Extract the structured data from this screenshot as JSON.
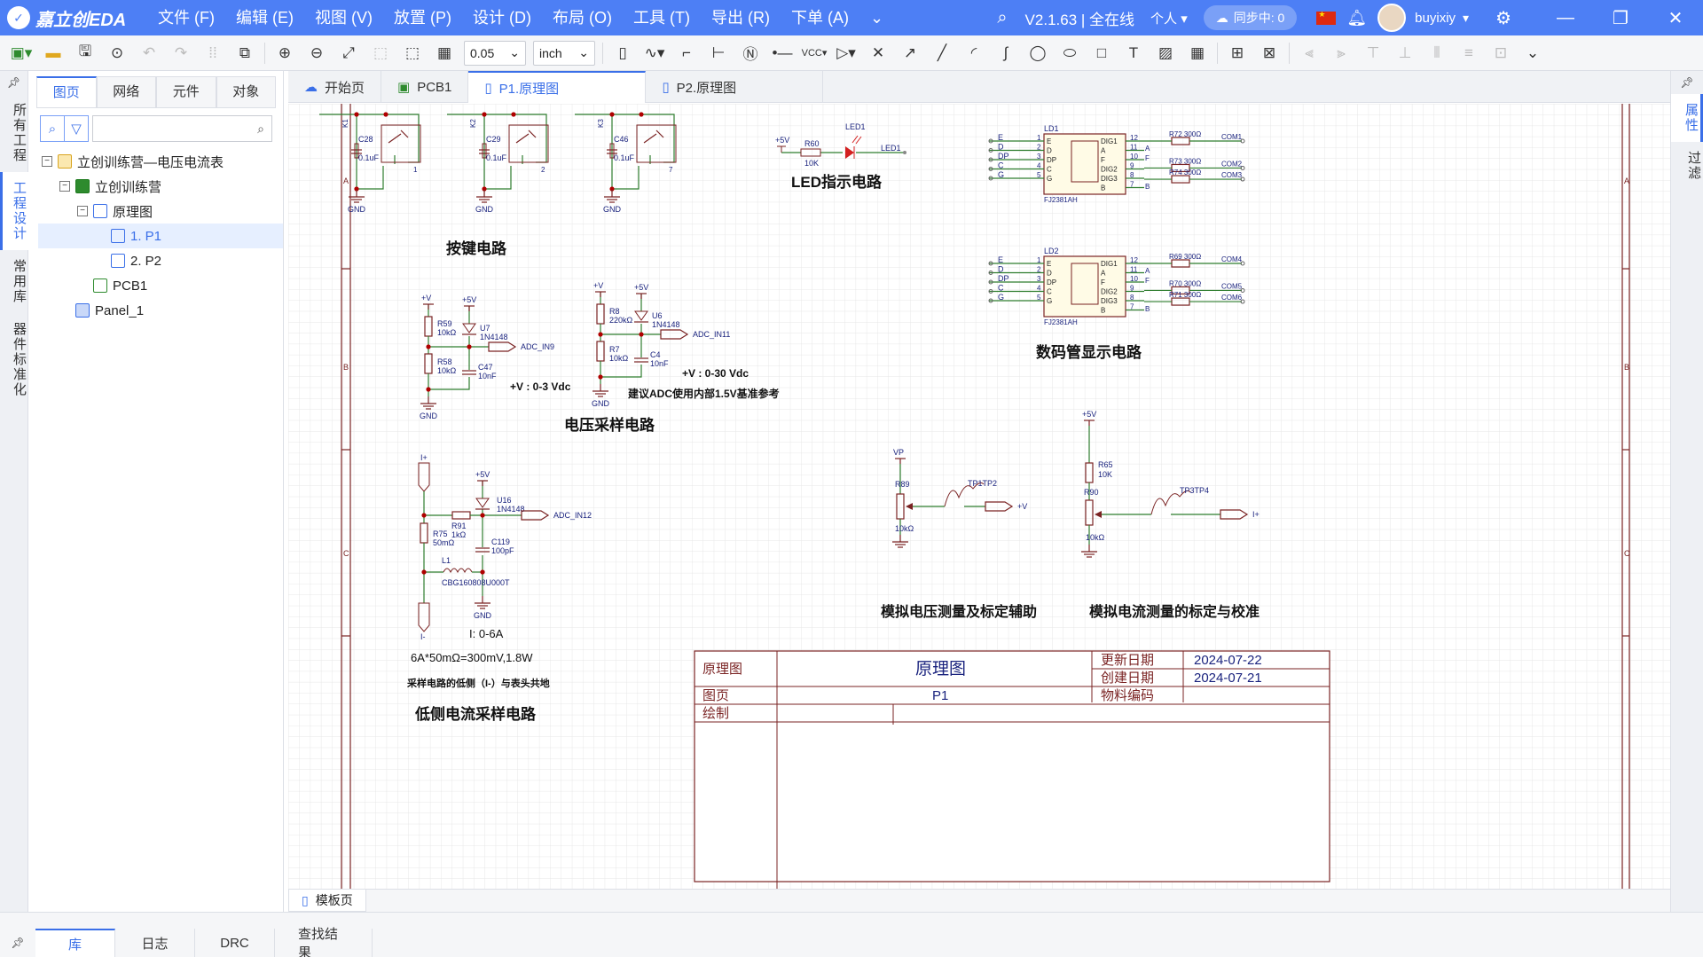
{
  "app": {
    "name": "嘉立创EDA",
    "version": "V2.1.63 | 全在线",
    "workspace": "个人",
    "sync": "同步中: 0",
    "user": "buyixiy"
  },
  "menu": [
    "文件 (F)",
    "编辑 (E)",
    "视图 (V)",
    "放置 (P)",
    "设计 (D)",
    "布局 (O)",
    "工具 (T)",
    "导出 (R)",
    "下单 (A)"
  ],
  "toolbar": {
    "grid": "0.05",
    "unit": "inch"
  },
  "left_rail": [
    "所有工程",
    "工程设计",
    "常用库",
    "器件标准化"
  ],
  "panel_tabs": [
    "图页",
    "网络",
    "元件",
    "对象"
  ],
  "tree": [
    {
      "label": "立创训练营—电压电流表",
      "level": 0
    },
    {
      "label": "立创训练营",
      "level": 1
    },
    {
      "label": "原理图",
      "level": 2
    },
    {
      "label": "1. P1",
      "level": 3,
      "selected": true
    },
    {
      "label": "2. P2",
      "level": 3
    },
    {
      "label": "PCB1",
      "level": 2
    },
    {
      "label": "Panel_1",
      "level": 1
    }
  ],
  "editor_tabs": [
    "开始页",
    "PCB1",
    "P1.原理图",
    "P2.原理图"
  ],
  "right_rail": [
    "属性",
    "过滤"
  ],
  "sheet_tab": "模板页",
  "bottom_tabs": [
    "库",
    "日志",
    "DRC",
    "查找结果"
  ],
  "schematic": {
    "titles": {
      "key": "按键电路",
      "led": "LED指示电路",
      "seg": "数码管显示电路",
      "vsample": "电压采样电路",
      "isample": "低侧电流采样电路",
      "vcal": "模拟电压测量及标定辅助",
      "ical": "模拟电流测量的标定与校准"
    },
    "notes": {
      "v1": "+V : 0-3 Vdc",
      "v2": "+V : 0-30 Vdc",
      "adc": "建议ADC使用内部1.5V基准参考",
      "i1": "I:  0-6A",
      "i2": "6A*50mΩ=300mV,1.8W",
      "i3": "采样电路的低侧（I-）与表头共地"
    },
    "keys": [
      {
        "ref": "K1",
        "cap": "C28",
        "val": "0.1uF",
        "pin": "1"
      },
      {
        "ref": "K2",
        "cap": "C29",
        "val": "0.1uF",
        "pin": "2"
      },
      {
        "ref": "K3",
        "cap": "C46",
        "val": "0.1uF",
        "pin": "7"
      }
    ],
    "led": {
      "vcc": "+5V",
      "res": "R60",
      "rval": "10K",
      "ref": "LED1",
      "net": "LED1"
    },
    "displays": [
      {
        "ref": "LD1",
        "part": "FJ2381AH",
        "pins": [
          "E",
          "D",
          "DP",
          "C",
          "G"
        ],
        "pinnums": [
          "1",
          "2",
          "3",
          "4",
          "5"
        ],
        "rpins": [
          "12",
          "11",
          "10",
          "9",
          "8",
          "7"
        ],
        "rlabels": [
          "DIG1",
          "A",
          "F",
          "DIG2",
          "DIG3",
          "B"
        ],
        "res": [
          {
            "r": "R72",
            "v": "300Ω",
            "net": "COM1"
          },
          {
            "r": "R73",
            "v": "300Ω",
            "net": "COM2"
          },
          {
            "r": "R74",
            "v": "300Ω",
            "net": "COM3"
          }
        ]
      },
      {
        "ref": "LD2",
        "part": "FJ2381AH",
        "pins": [
          "E",
          "D",
          "DP",
          "C",
          "G"
        ],
        "pinnums": [
          "1",
          "2",
          "3",
          "4",
          "5"
        ],
        "rpins": [
          "12",
          "11",
          "10",
          "9",
          "8",
          "7"
        ],
        "rlabels": [
          "DIG1",
          "A",
          "F",
          "DIG2",
          "DIG3",
          "B"
        ],
        "res": [
          {
            "r": "R69",
            "v": "300Ω",
            "net": "COM4"
          },
          {
            "r": "R70",
            "v": "300Ω",
            "net": "COM5"
          },
          {
            "r": "R71",
            "v": "300Ω",
            "net": "COM6"
          }
        ]
      }
    ],
    "vsample1": {
      "vin": "+V",
      "vcc": "+5V",
      "r1": "R59",
      "r1v": "10kΩ",
      "r2": "R58",
      "r2v": "10kΩ",
      "d": "U7",
      "dv": "1N4148",
      "c": "C47",
      "cv": "10nF",
      "net": "ADC_IN9",
      "gnd": "GND"
    },
    "vsample2": {
      "vin": "+V",
      "vcc": "+5V",
      "r1": "R8",
      "r1v": "220kΩ",
      "r2": "R7",
      "r2v": "10kΩ",
      "d": "U6",
      "dv": "1N4148",
      "c": "C4",
      "cv": "10nF",
      "net": "ADC_IN11",
      "gnd": "GND"
    },
    "isample": {
      "ip": "I+",
      "im": "I-",
      "vcc": "+5V",
      "d": "U16",
      "dv": "1N4148",
      "r1": "R75",
      "r1v": "50mΩ",
      "r2": "R91",
      "r2v": "1kΩ",
      "c": "C119",
      "cv": "100pF",
      "l": "L1",
      "lv": "CBG160808U000T",
      "net": "ADC_IN12",
      "gnd": "GND"
    },
    "vcal": {
      "vp": "VP",
      "r": "R89",
      "rv": "10kΩ",
      "tp": "TP1",
      "tp2": "TP2",
      "net": "+V"
    },
    "ical": {
      "vcc": "+5V",
      "r1": "R65",
      "r1v": "10K",
      "r2": "R90",
      "r2v": "10kΩ",
      "tp": "TP3",
      "tp2": "TP4",
      "net": "I+"
    },
    "border_rows": [
      "A",
      "B",
      "C"
    ],
    "titleblock": {
      "k1": "原理图",
      "title": "原理图",
      "k2": "更新日期",
      "v2": "2024-07-22",
      "k3": "创建日期",
      "v3": "2024-07-21",
      "k4": "图页",
      "v4": "P1",
      "k5": "物料编码",
      "v5": "",
      "k6": "绘制"
    }
  }
}
